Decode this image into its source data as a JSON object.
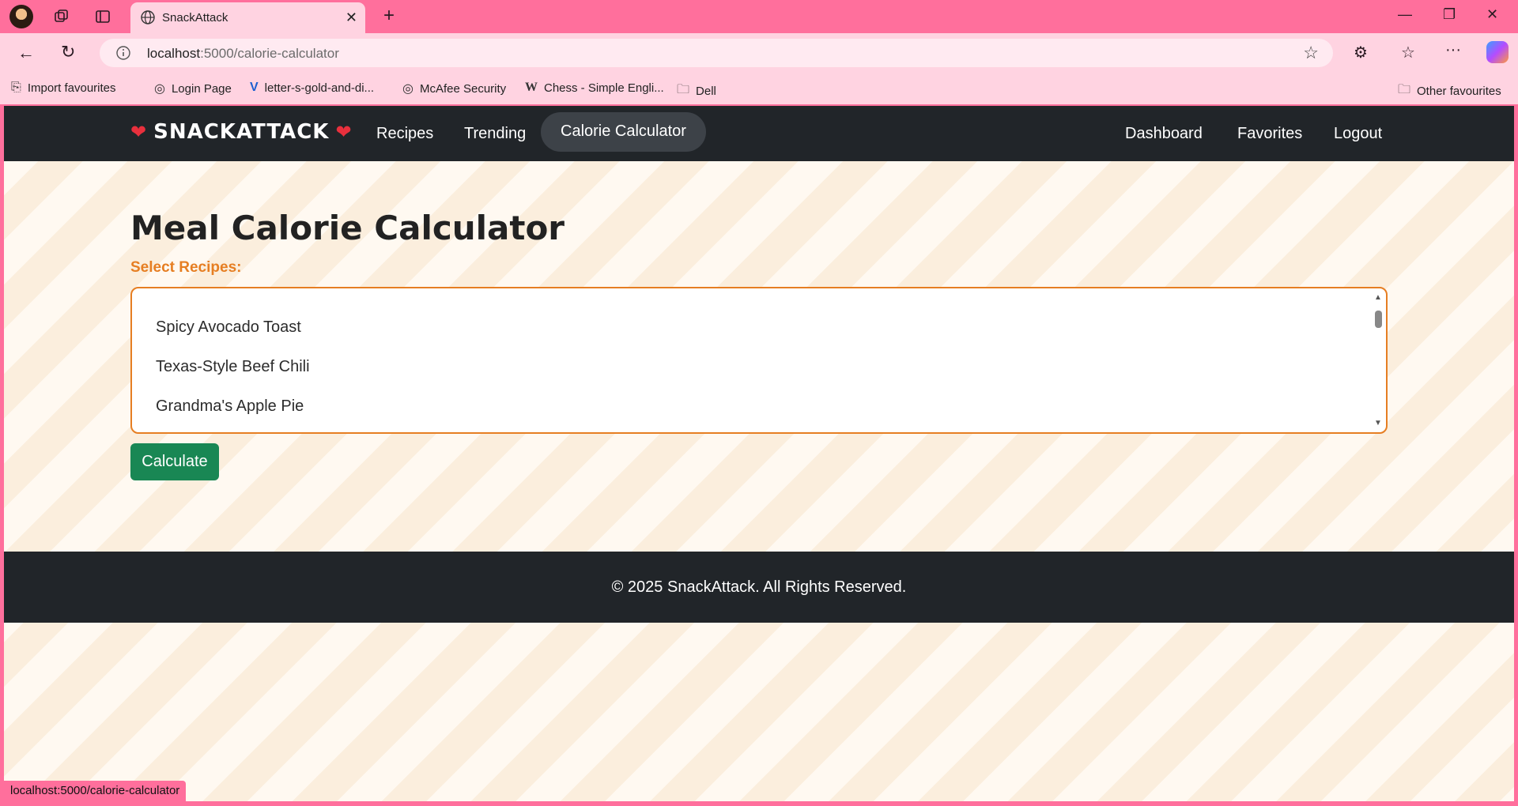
{
  "browser": {
    "tab_title": "SnackAttack",
    "url_host": "localhost",
    "url_path": ":5000/calorie-calculator",
    "status_url": "localhost:5000/calorie-calculator",
    "bookmarks": [
      {
        "label": "Import favourites",
        "icon": "import-icon"
      },
      {
        "label": "Login Page",
        "icon": "globe-icon"
      },
      {
        "label": "letter-s-gold-and-di...",
        "icon": "v-logo-icon"
      },
      {
        "label": "McAfee Security",
        "icon": "globe-icon"
      },
      {
        "label": "Chess - Simple Engli...",
        "icon": "wikipedia-icon"
      },
      {
        "label": "Dell",
        "icon": "folder-icon"
      }
    ],
    "other_favourites": "Other favourites"
  },
  "navbar": {
    "brand": "SNACKATTACK",
    "links": [
      "Recipes",
      "Trending",
      "Calorie Calculator"
    ],
    "active_link": "Calorie Calculator",
    "right_links": [
      "Dashboard",
      "Favorites",
      "Logout"
    ]
  },
  "main": {
    "title": "Meal Calorie Calculator",
    "select_label": "Select Recipes:",
    "recipes": [
      "Spicy Avocado Toast",
      "Texas-Style Beef Chili",
      "Grandma's Apple Pie"
    ],
    "calculate_label": "Calculate"
  },
  "footer": {
    "text": "© 2025 SnackAttack. All Rights Reserved."
  },
  "colors": {
    "chrome_pink": "#ff6f9c",
    "navbar_bg": "#212529",
    "accent_orange": "#e67e22",
    "button_green": "#198754"
  }
}
